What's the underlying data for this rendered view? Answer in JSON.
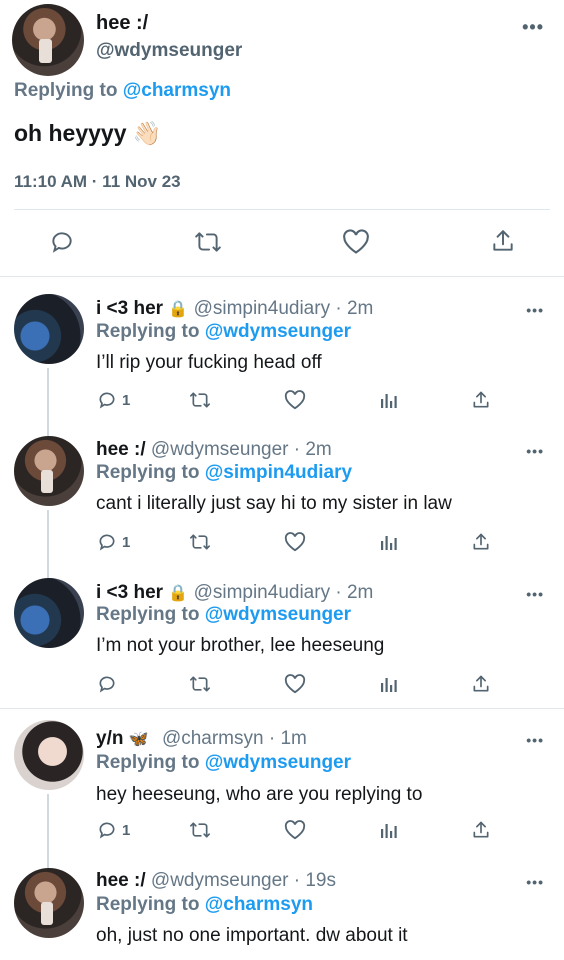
{
  "main": {
    "name": "hee :/",
    "handle": "@wdymseunger",
    "replying_prefix": "Replying to",
    "replying_to": "@charmsyn",
    "text": "oh heyyyy 👋🏻",
    "timestamp": "11:10 AM · 11 Nov 23",
    "more": "•••"
  },
  "replies": [
    {
      "name": "i <3 her",
      "lock": "🔒",
      "meta": "@simpin4udiary · 2m",
      "replying_prefix": "Replying to",
      "replying_to": "@wdymseunger",
      "text": "I’ll rip your fucking head off",
      "reply_count": "1"
    },
    {
      "name": "hee :/",
      "meta": "@wdymseunger · 2m",
      "replying_prefix": "Replying to",
      "replying_to": "@simpin4udiary",
      "text": "cant i literally just say hi to my sister in law",
      "reply_count": "1"
    },
    {
      "name": "i <3 her",
      "lock": "🔒",
      "meta": "@simpin4udiary · 2m",
      "replying_prefix": "Replying to",
      "replying_to": "@wdymseunger",
      "text": "I’m not your brother, lee heeseung",
      "reply_count": ""
    },
    {
      "name": "y/n",
      "emoji": "🦋",
      "meta": "@charmsyn · 1m",
      "replying_prefix": "Replying to",
      "replying_to": "@wdymseunger",
      "text": "hey heeseung, who are you replying to",
      "reply_count": "1"
    },
    {
      "name": "hee :/",
      "meta": "@wdymseunger · 19s",
      "replying_prefix": "Replying to",
      "replying_to": "@charmsyn",
      "text": "oh, just no one important. dw about it",
      "reply_count": ""
    }
  ],
  "icons": {
    "reply": "reply-icon",
    "retweet": "retweet-icon",
    "like": "heart-icon",
    "views": "views-icon",
    "share": "share-icon"
  },
  "colors": {
    "link": "#1d9bf0",
    "secondary": "#657786",
    "divider": "#e1e8ed"
  }
}
